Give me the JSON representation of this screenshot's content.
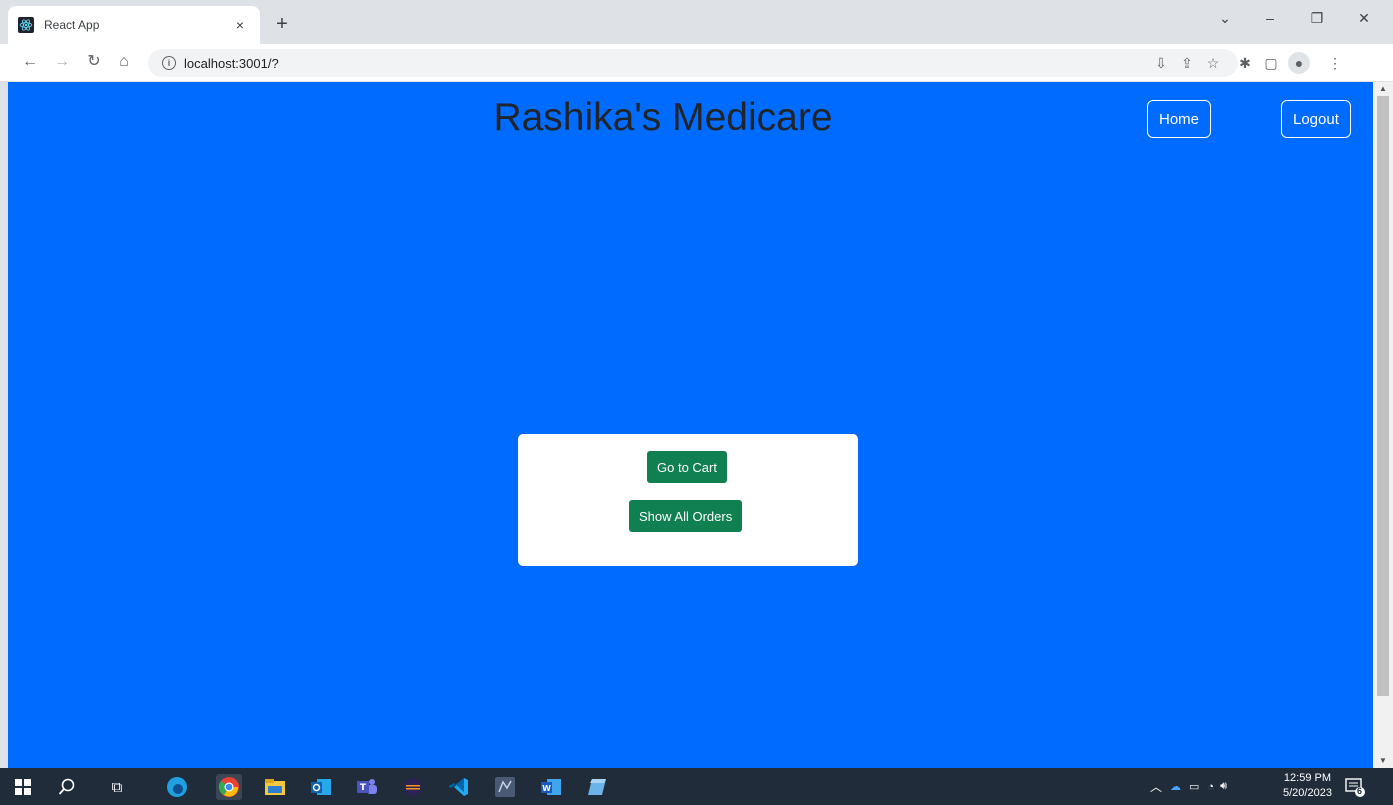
{
  "browser": {
    "tab_title": "React App",
    "tab_close": "×",
    "new_tab": "+",
    "url": "localhost:3001/?",
    "window_controls": {
      "dropdown": "⌄",
      "minimize": "–",
      "restore": "❐",
      "close": "✕"
    }
  },
  "page": {
    "title": "Rashika's Medicare",
    "nav": {
      "home_label": "Home",
      "logout_label": "Logout"
    },
    "card": {
      "cart_button_label": "Go to Cart",
      "orders_button_label": "Show All Orders"
    }
  },
  "taskbar": {
    "time": "12:59 PM",
    "date": "5/20/2023",
    "notification_count": "6"
  },
  "colors": {
    "page_background": "#006bff",
    "button_green": "#108051",
    "taskbar": "#202c3a"
  }
}
